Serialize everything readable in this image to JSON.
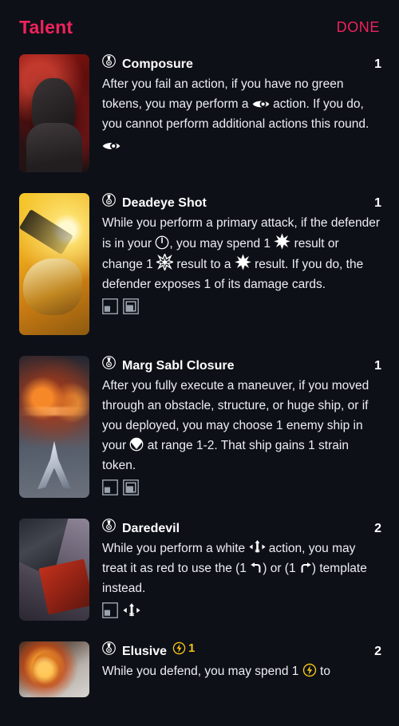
{
  "header": {
    "title": "Talent",
    "done_label": "DONE"
  },
  "colors": {
    "accent": "#f0225c",
    "background": "#0d1017",
    "text": "#eceef2",
    "charge": "#f2c21a"
  },
  "cards": [
    {
      "id": "composure",
      "slot_icon": "talent-medal-icon",
      "name": "Composure",
      "cost": "1",
      "charge": null,
      "art": "art-composure",
      "art_name": "composure-card-art",
      "text_parts": [
        {
          "type": "text",
          "value": "After you fail an action, if you have no green tokens, you may perform a "
        },
        {
          "type": "icon",
          "value": "focus-eye-icon"
        },
        {
          "type": "text",
          "value": " action. If you do, you cannot perform additional actions this round."
        }
      ],
      "footer_icons": [
        "focus-eye-icon"
      ]
    },
    {
      "id": "deadeye-shot",
      "slot_icon": "talent-medal-icon",
      "name": "Deadeye Shot",
      "cost": "1",
      "charge": null,
      "art": "art-deadeye",
      "art_name": "deadeye-shot-card-art",
      "text_parts": [
        {
          "type": "text",
          "value": "While you perform a primary attack, if the defender is in your "
        },
        {
          "type": "icon",
          "value": "bullseye-arc-icon"
        },
        {
          "type": "text",
          "value": ", you may spend 1 "
        },
        {
          "type": "icon",
          "value": "hit-icon"
        },
        {
          "type": "text",
          "value": " result or change 1 "
        },
        {
          "type": "icon",
          "value": "crit-icon"
        },
        {
          "type": "text",
          "value": " result to a "
        },
        {
          "type": "icon",
          "value": "hit-icon"
        },
        {
          "type": "text",
          "value": " result. If you do, the defender exposes 1 of its damage cards."
        }
      ],
      "footer_icons": [
        "small-base-icon",
        "medium-base-icon"
      ]
    },
    {
      "id": "marg-sabl-closure",
      "slot_icon": "talent-medal-icon",
      "name": "Marg Sabl Closure",
      "cost": "1",
      "charge": null,
      "art": "art-margsabl",
      "art_name": "marg-sabl-closure-card-art",
      "text_parts": [
        {
          "type": "text",
          "value": "After you fully execute a maneuver, if you moved through an obstacle, structure, or huge ship, or if you deployed, you may choose 1 enemy ship in your "
        },
        {
          "type": "icon",
          "value": "front-arc-icon"
        },
        {
          "type": "text",
          "value": " at range 1-2. That ship gains 1 strain token."
        }
      ],
      "footer_icons": [
        "small-base-icon",
        "medium-base-icon"
      ]
    },
    {
      "id": "daredevil",
      "slot_icon": "talent-medal-icon",
      "name": "Daredevil",
      "cost": "2",
      "charge": null,
      "art": "art-daredevil",
      "art_name": "daredevil-card-art",
      "text_parts": [
        {
          "type": "text",
          "value": "While you perform a white "
        },
        {
          "type": "icon",
          "value": "barrel-roll-icon"
        },
        {
          "type": "text",
          "value": " action, you may treat it as red to use the (1 "
        },
        {
          "type": "icon",
          "value": "bank-left-template-icon"
        },
        {
          "type": "text",
          "value": ") or (1 "
        },
        {
          "type": "icon",
          "value": "bank-right-template-icon"
        },
        {
          "type": "text",
          "value": ") template instead."
        }
      ],
      "footer_icons": [
        "small-base-icon",
        "barrel-roll-icon"
      ]
    },
    {
      "id": "elusive",
      "slot_icon": "talent-medal-icon",
      "name": "Elusive",
      "cost": "2",
      "charge": "1",
      "charge_icon": "charge-bolt-icon",
      "art": "art-elusive",
      "art_name": "elusive-card-art",
      "text_parts": [
        {
          "type": "text",
          "value": "While you defend, you may spend 1 "
        },
        {
          "type": "icon",
          "value": "charge-bolt-icon"
        },
        {
          "type": "text",
          "value": " to"
        }
      ],
      "footer_icons": []
    }
  ]
}
